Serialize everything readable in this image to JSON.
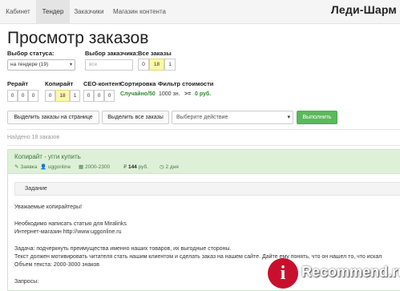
{
  "nav": {
    "items": [
      {
        "label": "Кабинет"
      },
      {
        "label": "Тендер"
      },
      {
        "label": "Заказчики"
      },
      {
        "label": "Магазин контента"
      }
    ],
    "active_index": 1,
    "logo_text": "Леди-Шарм"
  },
  "page": {
    "title": "Просмотр заказов"
  },
  "filters": {
    "status": {
      "label": "Выбор статуса:",
      "value": "на тендере (19)"
    },
    "customer": {
      "label": "Выбор заказчика:",
      "placeholder": "все"
    },
    "all_orders": {
      "label": "Все заказы",
      "values": [
        "0",
        "18",
        "1"
      ],
      "highlight_index": 1
    },
    "rewrite": {
      "label": "Рерайт",
      "values": [
        "0",
        "0",
        "0"
      ]
    },
    "copywrite": {
      "label": "Копирайт",
      "values": [
        "0",
        "18",
        "1"
      ],
      "highlight_index": 1
    },
    "seo": {
      "label": "СЕО-контент",
      "values": [
        "0",
        "0",
        "0"
      ]
    },
    "sort": {
      "label": "Сортировка",
      "value": "Случайно/50"
    },
    "price": {
      "label": "Фильтр стоимости",
      "value": "1000 зн.",
      "compare": ">=",
      "amount": "0 руб."
    }
  },
  "actions": {
    "select_page": "Выделить заказы на странице",
    "select_all": "Выделить все заказы",
    "action_placeholder": "Выберите действие",
    "execute": "Выполнить"
  },
  "found": {
    "text": "Найдено 18 заказов"
  },
  "order": {
    "title": "Копирайт - угги купить",
    "type": "Заявка",
    "customer": "uggonline",
    "volume": "2000-2300",
    "price": "144",
    "price_unit": "руб.",
    "deadline": "2 дня",
    "task_label": "Задание",
    "body": [
      "Уважаемые копирайтеры!",
      "",
      "Необходимо написать статью для Miralinks",
      "Интернет-магазин http://www.uggonline.ru",
      "",
      "Задача: подчеркнуть преимущества именно наших товаров, их выгодные стороны.",
      "Текст должен мотивировать читателя стать нашим клиентом и сделать заказ на нашем сайте. Дайте ему понять, что он нашел то, что искал",
      "Объем текста: 2000-3000 знаков",
      "",
      "Запросы:"
    ]
  },
  "watermark": {
    "letter": "i",
    "text": "Recommend.ru"
  },
  "colors": {
    "accent_green": "#5cb85c",
    "panel_green": "#dff0d8",
    "highlight_yellow": "#fbf8a8",
    "link_green": "#2e8b2e",
    "brand_red": "#c8102e"
  }
}
